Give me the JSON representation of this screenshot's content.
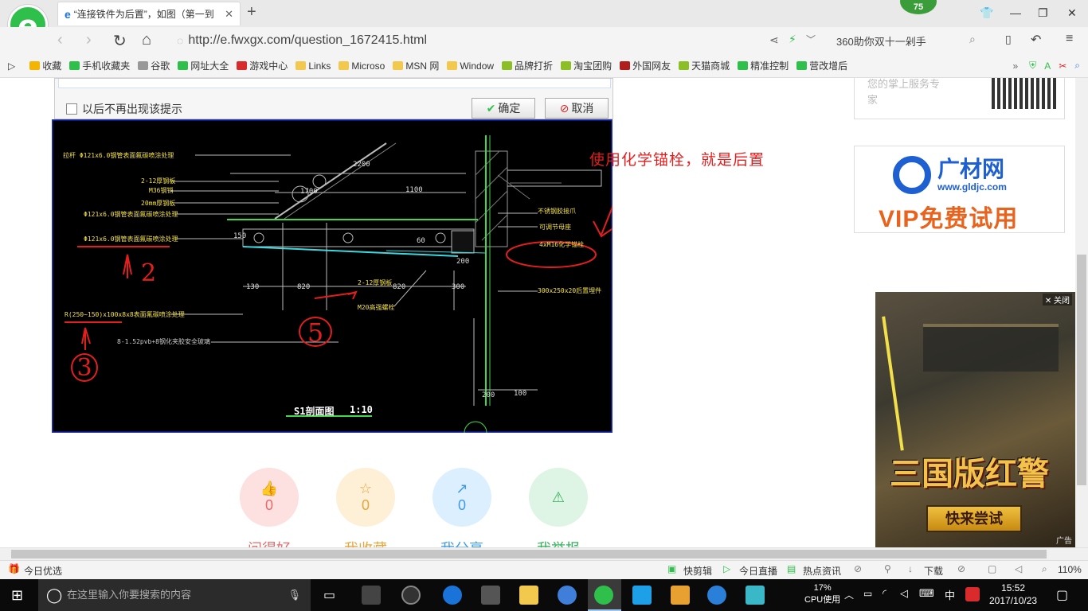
{
  "browser": {
    "tab_title": "“连接铁件为后置”，如图（第一到",
    "url": "http://e.fwxgx.com/question_1672415.html",
    "notification_count": "75",
    "search_text": "360助你双十一剁手"
  },
  "bookmarks": [
    {
      "label": "收藏",
      "color": "#f5b400"
    },
    {
      "label": "手机收藏夹",
      "color": "#2fbf4b"
    },
    {
      "label": "谷歌",
      "color": "#999"
    },
    {
      "label": "网址大全",
      "color": "#2fbf4b"
    },
    {
      "label": "游戏中心",
      "color": "#d92b2b"
    },
    {
      "label": "Links",
      "color": "#f2c94c"
    },
    {
      "label": "Microso",
      "color": "#f2c94c"
    },
    {
      "label": "MSN 网",
      "color": "#f2c94c"
    },
    {
      "label": "Window",
      "color": "#f2c94c"
    },
    {
      "label": "品牌打折",
      "color": "#8cbf26"
    },
    {
      "label": "淘宝团购",
      "color": "#8cbf26"
    },
    {
      "label": "外国网友",
      "color": "#b01d1d"
    },
    {
      "label": "天猫商城",
      "color": "#8cbf26"
    },
    {
      "label": "精准控制",
      "color": "#2fbf4b"
    },
    {
      "label": "营改增后",
      "color": "#2fbf4b"
    }
  ],
  "dialog": {
    "checkbox_label": "以后不再出现该提示",
    "ok_label": "确定",
    "cancel_label": "取消"
  },
  "cad": {
    "labels": [
      "拉杆 Φ121x6.0钢管表面氟碳喷涂处理",
      "2-12厚钢板",
      "M36钢销",
      "20mm厚钢板",
      "Φ121x6.0钢管表面氟碳喷涂处理",
      "Φ121x6.0钢管表面氟碳喷涂处理",
      "R(250~150)x100x8x8表面氟碳喷涂处理",
      "8-1.52pvb+8钢化夹胶安全玻璃",
      "2-12厚钢板",
      "M20高强螺栓",
      "不锈钢胶接爪",
      "可调节母座",
      "4xM16化学锚栓",
      "300x250x20后置埋件",
      "S1剖面图",
      "1:10"
    ],
    "dims": [
      "2200",
      "1100",
      "1700",
      "150",
      "130",
      "820",
      "820",
      "300",
      "200",
      "200",
      "100",
      "60"
    ],
    "annotation": "使用化学锚栓，就是后置",
    "marks": [
      "2",
      "5",
      "3"
    ]
  },
  "actions": [
    {
      "label": "问得好",
      "count": "0",
      "color": "#fde0e0",
      "fg": "#e86a6a"
    },
    {
      "label": "我收藏",
      "count": "0",
      "color": "#fdf0d6",
      "fg": "#e8a53c"
    },
    {
      "label": "我分享",
      "count": "0",
      "color": "#dcefff",
      "fg": "#3f9ae8"
    },
    {
      "label": "我举报",
      "count": "",
      "color": "#def4e4",
      "fg": "#34b15a"
    }
  ],
  "sidebar": {
    "service_text_1": "您的掌上服务专",
    "service_text_2": "家",
    "ad_brand": "广材网",
    "ad_url": "www.gldjc.com",
    "ad_slogan": "VIP免费试用",
    "game_close": "关闭",
    "game_title": "三国版红警",
    "game_button": "快来尝试",
    "game_ad_tag": "广告"
  },
  "statusbar": {
    "left": "今日优选",
    "items": [
      "快剪辑",
      "今日直播",
      "热点资讯",
      "下载"
    ],
    "zoom": "110%"
  },
  "taskbar": {
    "search_placeholder": "在这里输入你要搜索的内容",
    "cpu_percent": "17%",
    "cpu_label": "CPU使用",
    "ime": "中",
    "time": "15:52",
    "date": "2017/10/23"
  }
}
